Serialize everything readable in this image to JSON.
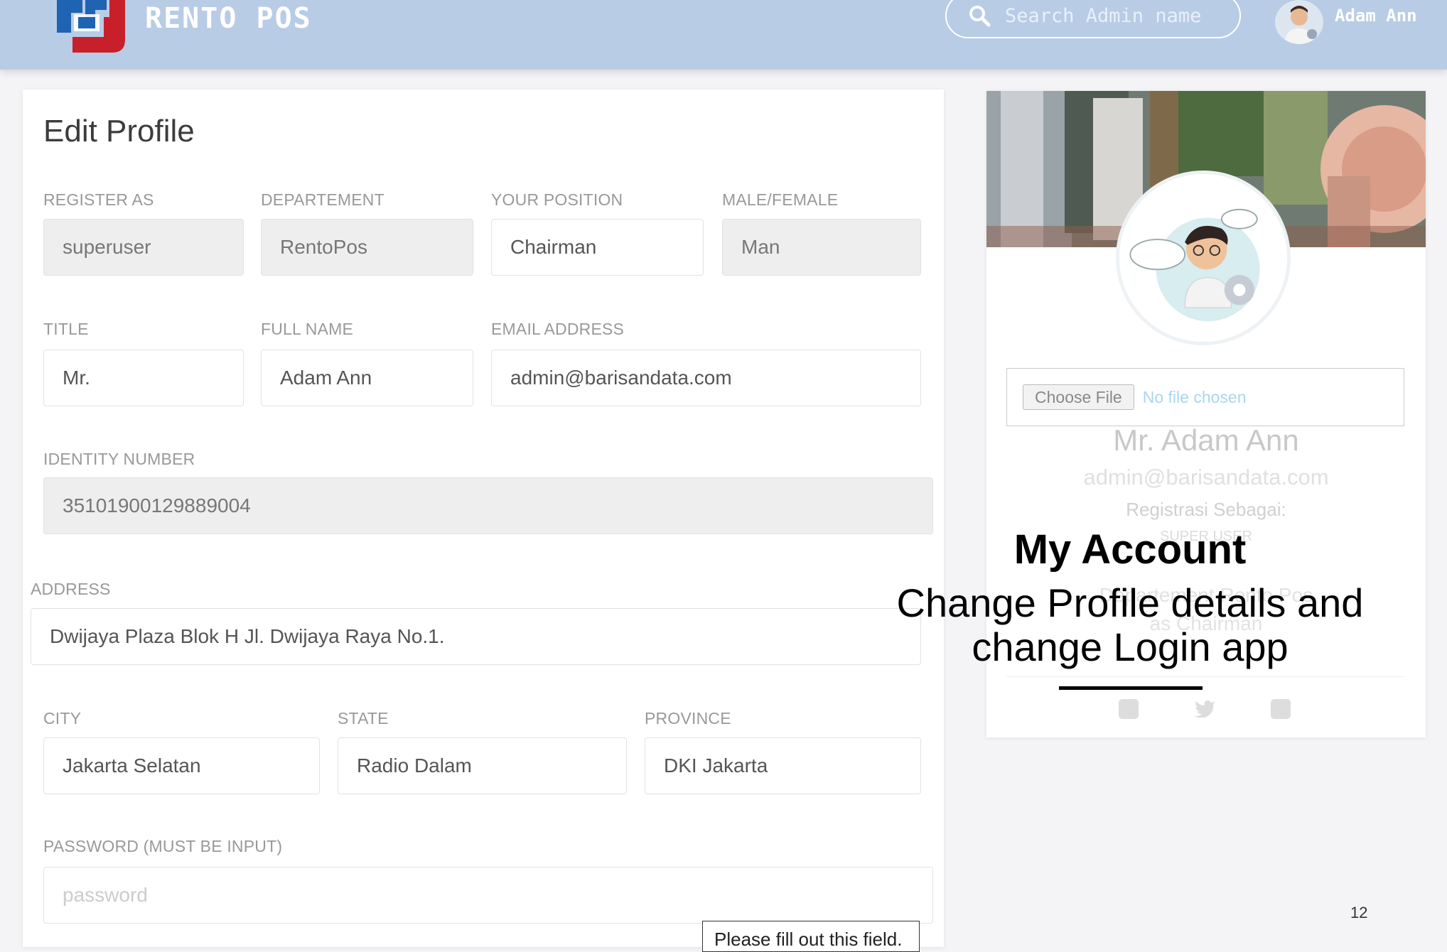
{
  "header": {
    "brand": "RENTO POS",
    "search_placeholder": "Search Admin name",
    "user_name": "Adam Ann"
  },
  "form": {
    "title": "Edit Profile",
    "register_as": {
      "label": "REGISTER AS",
      "value": "superuser"
    },
    "department": {
      "label": "DEPARTEMENT",
      "value": "RentoPos"
    },
    "position": {
      "label": "YOUR POSITION",
      "value": "Chairman"
    },
    "gender": {
      "label": "MALE/FEMALE",
      "value": "Man"
    },
    "title_field": {
      "label": "TITLE",
      "value": "Mr."
    },
    "full_name": {
      "label": "FULL NAME",
      "value": "Adam Ann"
    },
    "email": {
      "label": "EMAIL ADDRESS",
      "value": "admin@barisandata.com"
    },
    "identity": {
      "label": "IDENTITY NUMBER",
      "value": "35101900129889004"
    },
    "address": {
      "label": "ADDRESS",
      "value": "Dwijaya Plaza Blok H Jl. Dwijaya Raya No.1."
    },
    "city": {
      "label": "CITY",
      "value": "Jakarta Selatan"
    },
    "state": {
      "label": "STATE",
      "value": "Radio Dalam"
    },
    "province": {
      "label": "PROVINCE",
      "value": "DKI Jakarta"
    },
    "password": {
      "label": "PASSWORD (MUST BE INPUT)",
      "placeholder": "password"
    },
    "validation_tooltip": "Please fill out this field."
  },
  "profile_card": {
    "choose_file": "Choose File",
    "file_status": "No file chosen",
    "name": "Mr. Adam Ann",
    "email": "admin@barisandata.com",
    "registered_as": "Registrasi Sebagai:",
    "role": "SUPER USER",
    "department": "Departement Rento Pos",
    "position": "as Chairman"
  },
  "overlay": {
    "title": "My Account",
    "subtitle_line1": "Change Profile details and",
    "subtitle_line2": "change Login app"
  },
  "page_number": "12",
  "colors": {
    "header": "#b8cce6",
    "logo_blue": "#1f63b3",
    "logo_red": "#c8202a"
  }
}
